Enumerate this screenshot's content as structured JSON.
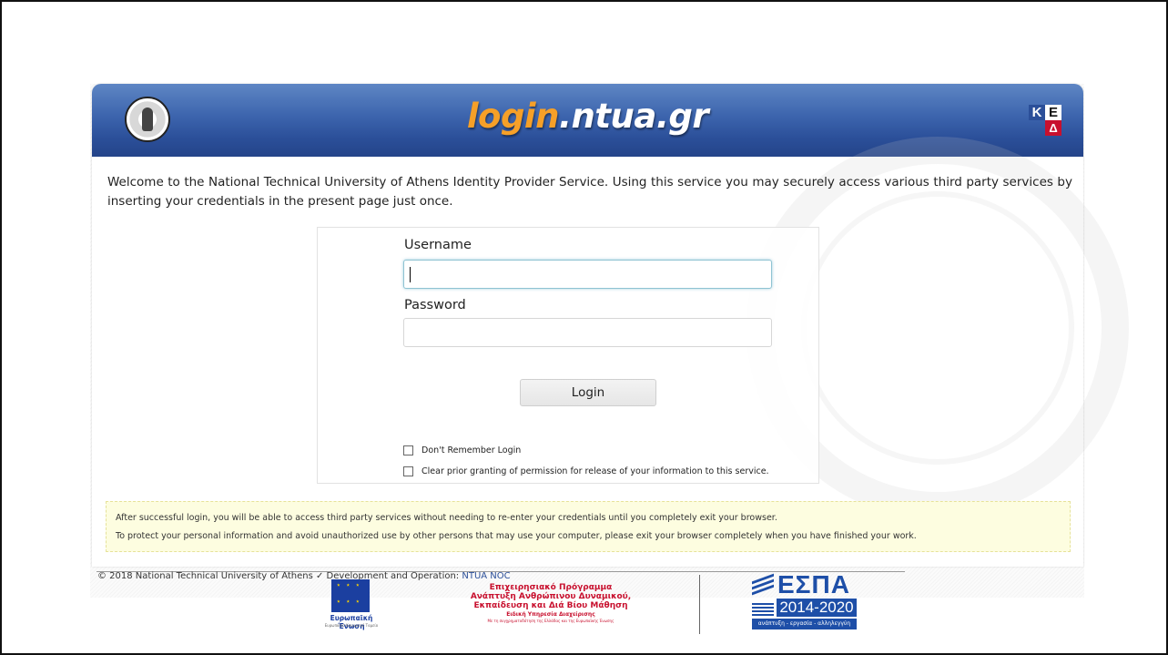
{
  "header": {
    "title_accent": "login",
    "title_rest": ".ntua.gr",
    "ked_k": "K",
    "ked_e": "E",
    "ked_d": "Δ"
  },
  "welcome_text": "Welcome to the National Technical University of Athens Identity Provider Service. Using this service you may securely access various third party services by inserting your credentials in the present page just once.",
  "form": {
    "username_label": "Username",
    "username_value": "",
    "password_label": "Password",
    "password_value": "",
    "login_button": "Login",
    "checkbox_dont_remember": "Don't Remember Login",
    "checkbox_clear_consent": "Clear prior granting of permission for release of your information to this service."
  },
  "notice": {
    "line1": "After successful login, you will be able to access third party services without needing to re-enter your credentials until you completely exit your browser.",
    "line2": "To protect your personal information and avoid unauthorized use by other persons that may use your computer, please exit your browser completely when you have finished your work."
  },
  "footer": {
    "copyright": "© 2018 National Technical University of Athens ✓ Development and Operation: ",
    "noc": "NTUA NOC"
  },
  "logos": {
    "eu_caption": "Ευρωπαϊκή Ένωση",
    "eu_sub": "Ευρωπαϊκό Κοινωνικό Ταμείο",
    "op_line1": "Επιχειρησιακό Πρόγραμμα",
    "op_line2": "Ανάπτυξη Ανθρώπινου Δυναμικού,",
    "op_line3": "Εκπαίδευση και Διά Βίου Μάθηση",
    "op_line4": "Ειδική Υπηρεσία Διαχείρισης",
    "op_line5": "Με τη συγχρηματοδότηση της Ελλάδας και της Ευρωπαϊκής Ένωσης",
    "espa_title": "ΕΣΠΑ",
    "espa_years": "2014-2020",
    "espa_tag": "ανάπτυξη - εργασία - αλληλεγγύη"
  },
  "colors": {
    "header_blue": "#3c64ad",
    "accent_orange": "#f6a028",
    "notice_bg": "#fdfde0"
  }
}
